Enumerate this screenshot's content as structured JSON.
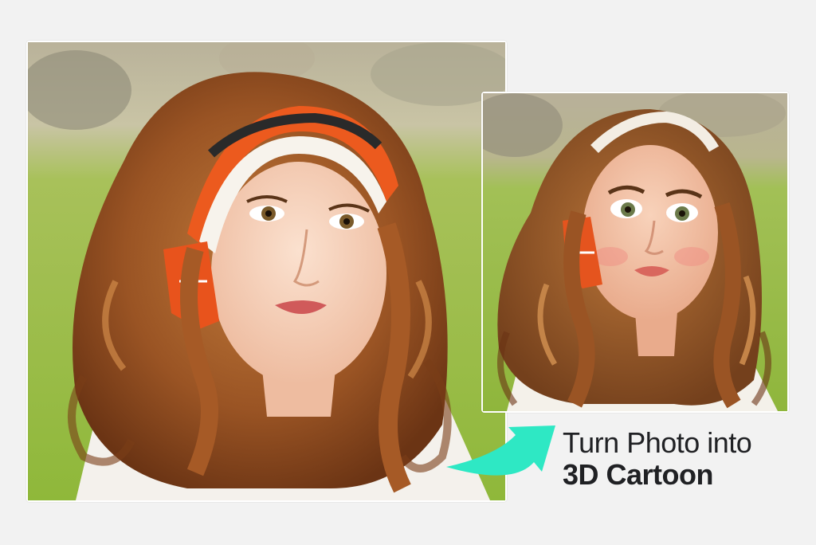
{
  "images": {
    "original": {
      "description_icon": "photo-woman-headband",
      "style": "photo"
    },
    "cartoon": {
      "description_icon": "cartoon-woman-headband",
      "style": "3d-cartoon"
    }
  },
  "caption": {
    "line1": "Turn Photo into",
    "line2": "3D Cartoon"
  },
  "colors": {
    "background": "#f2f2f2",
    "arrow": "#2ee8c4",
    "text": "#202124",
    "grass": "#9cc23e",
    "hair": "#9a5a2a",
    "scarf_orange": "#e8531c"
  },
  "icons": {
    "arrow": "curved-arrow-icon"
  }
}
